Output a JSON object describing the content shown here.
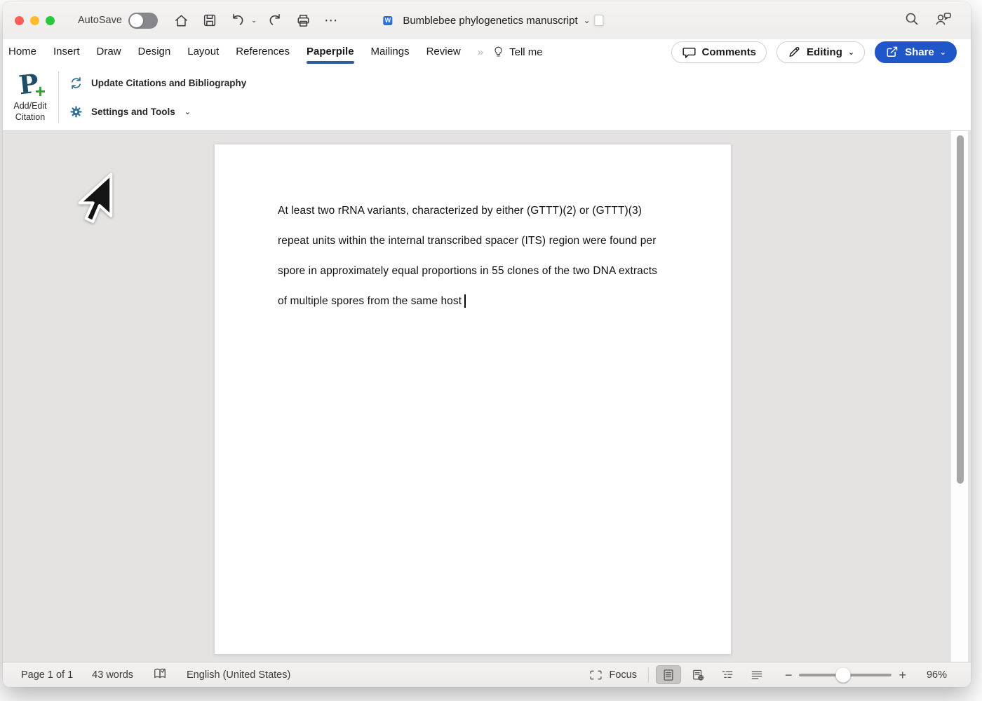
{
  "titlebar": {
    "autosave_label": "AutoSave",
    "more_glyph": "⋯",
    "doc_title": "Bumblebee phylogenetics manuscript",
    "word_badge_letter": "W"
  },
  "tabs": {
    "items": [
      {
        "label": "Home",
        "active": false
      },
      {
        "label": "Insert",
        "active": false
      },
      {
        "label": "Draw",
        "active": false
      },
      {
        "label": "Design",
        "active": false
      },
      {
        "label": "Layout",
        "active": false
      },
      {
        "label": "References",
        "active": false
      },
      {
        "label": "Paperpile",
        "active": true
      },
      {
        "label": "Mailings",
        "active": false
      },
      {
        "label": "Review",
        "active": false
      }
    ],
    "overflow_glyph": "»",
    "tell_me_label": "Tell me"
  },
  "top_actions": {
    "comments_label": "Comments",
    "editing_label": "Editing",
    "share_label": "Share"
  },
  "ribbon": {
    "add_edit_citation_line1": "Add/Edit",
    "add_edit_citation_line2": "Citation",
    "logo_letter": "P",
    "logo_plus": "+",
    "update_citations_label": "Update Citations and Bibliography",
    "settings_tools_label": "Settings and Tools"
  },
  "document": {
    "lines": [
      "At least two rRNA variants, characterized by either (GTTT)(2) or (GTTT)(3)",
      "repeat units within the internal transcribed spacer (ITS) region were found per",
      "spore in approximately equal proportions in 55 clones of the two DNA extracts",
      "of multiple spores from the same host"
    ]
  },
  "status_bar": {
    "page_indicator": "Page 1 of 1",
    "word_count": "43 words",
    "language": "English (United States)",
    "focus_label": "Focus",
    "zoom_level": "96%",
    "zoom_slider_percent": 47
  },
  "colors": {
    "share_button_blue": "#2057c8",
    "active_tab_underline": "#2b5d9b",
    "paperpile_icon_blue": "#2e6e93",
    "paperpile_logo_navy": "#1f4f68",
    "paperpile_logo_green": "#30a136",
    "traffic_red": "#ff5f57",
    "traffic_yellow": "#febc2e",
    "traffic_green": "#28c840"
  }
}
